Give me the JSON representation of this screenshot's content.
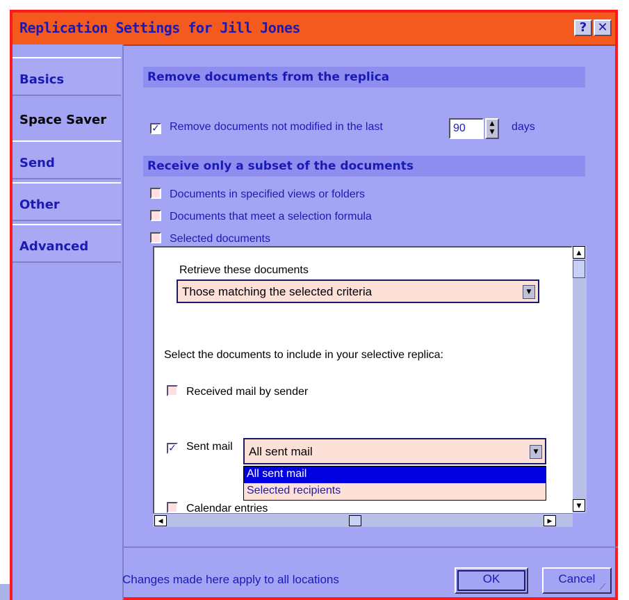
{
  "window": {
    "title": "Replication Settings for Jill Jones",
    "help_label": "?",
    "close_label": "✕"
  },
  "tabs": [
    "Basics",
    "Space Saver",
    "Send",
    "Other",
    "Advanced"
  ],
  "active_tab": "Space Saver",
  "remove_section": {
    "header": "Remove documents from the replica",
    "checkbox_label": "Remove documents not modified in the last",
    "checked": true,
    "days_value": "90",
    "days_unit": "days"
  },
  "subset_section": {
    "header": "Receive only a subset of the documents",
    "options": [
      {
        "label": "Documents in specified views or folders",
        "checked": false
      },
      {
        "label": "Documents that meet a selection formula",
        "checked": false
      },
      {
        "label": "Selected documents",
        "checked": false
      }
    ]
  },
  "selective": {
    "retrieve_label": "Retrieve these documents",
    "retrieve_value": "Those matching the selected criteria",
    "select_label": "Select the documents to include in your selective replica:",
    "received_mail_label": "Received mail by sender",
    "received_mail_checked": false,
    "sent_mail_label": "Sent mail",
    "sent_mail_checked": true,
    "sent_mail_value": "All sent mail",
    "sent_mail_options": [
      "All sent mail",
      "Selected recipients"
    ],
    "calendar_label": "Calendar entries",
    "calendar_checked": false
  },
  "footer": {
    "note": "Changes made here apply to all locations",
    "ok_label": "OK",
    "cancel_label": "Cancel"
  },
  "colors": {
    "window_bg": "#a4a4f5",
    "title_bg": "#f45a1e",
    "accent_text": "#1a1ab4",
    "border_red": "#ff1a1a",
    "dropdown_selected": "#0000e0"
  }
}
